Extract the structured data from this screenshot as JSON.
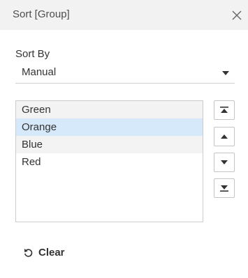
{
  "dialog": {
    "title": "Sort [Group]",
    "close_icon": "close-icon"
  },
  "sort_by": {
    "label": "Sort By",
    "selected": "Manual",
    "arrow_icon": "caret-down-icon"
  },
  "list": {
    "items": [
      {
        "label": "Green",
        "state": "alternate"
      },
      {
        "label": "Orange",
        "state": "selected"
      },
      {
        "label": "Blue",
        "state": "alternate"
      },
      {
        "label": "Red",
        "state": "normal"
      }
    ]
  },
  "move_buttons": [
    {
      "name": "move-to-top",
      "icon": "move-to-top-icon"
    },
    {
      "name": "move-up",
      "icon": "move-up-icon"
    },
    {
      "name": "move-down",
      "icon": "move-down-icon"
    },
    {
      "name": "move-to-bottom",
      "icon": "move-to-bottom-icon"
    }
  ],
  "clear": {
    "label": "Clear",
    "icon": "reset-icon"
  },
  "colors": {
    "title_bar_bg": "#f2f2f2",
    "selected_row": "#d5e9fb",
    "alternate_row": "#f3f3f3",
    "text": "#333333"
  }
}
